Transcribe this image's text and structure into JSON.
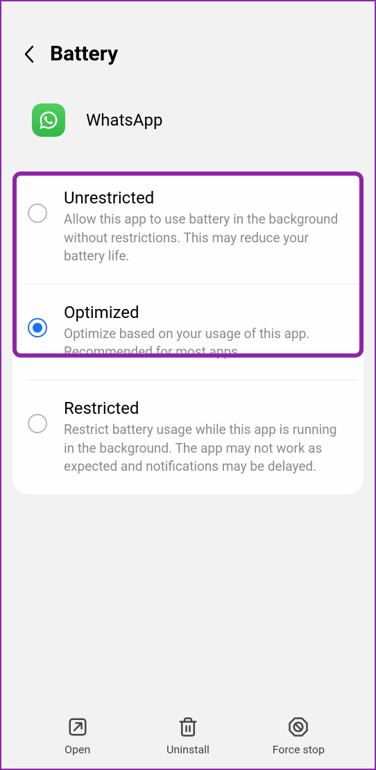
{
  "header": {
    "title": "Battery"
  },
  "app": {
    "name": "WhatsApp"
  },
  "options": [
    {
      "title": "Unrestricted",
      "description": "Allow this app to use battery in the background without restrictions. This may reduce your battery life.",
      "selected": false
    },
    {
      "title": "Optimized",
      "description": "Optimize based on your usage of this app. Recommended for most apps.",
      "selected": true
    },
    {
      "title": "Restricted",
      "description": "Restrict battery usage while this app is running in the background. The app may not work as expected and notifications may be delayed.",
      "selected": false
    }
  ],
  "bottom": {
    "open": "Open",
    "uninstall": "Uninstall",
    "forcestop": "Force stop"
  }
}
